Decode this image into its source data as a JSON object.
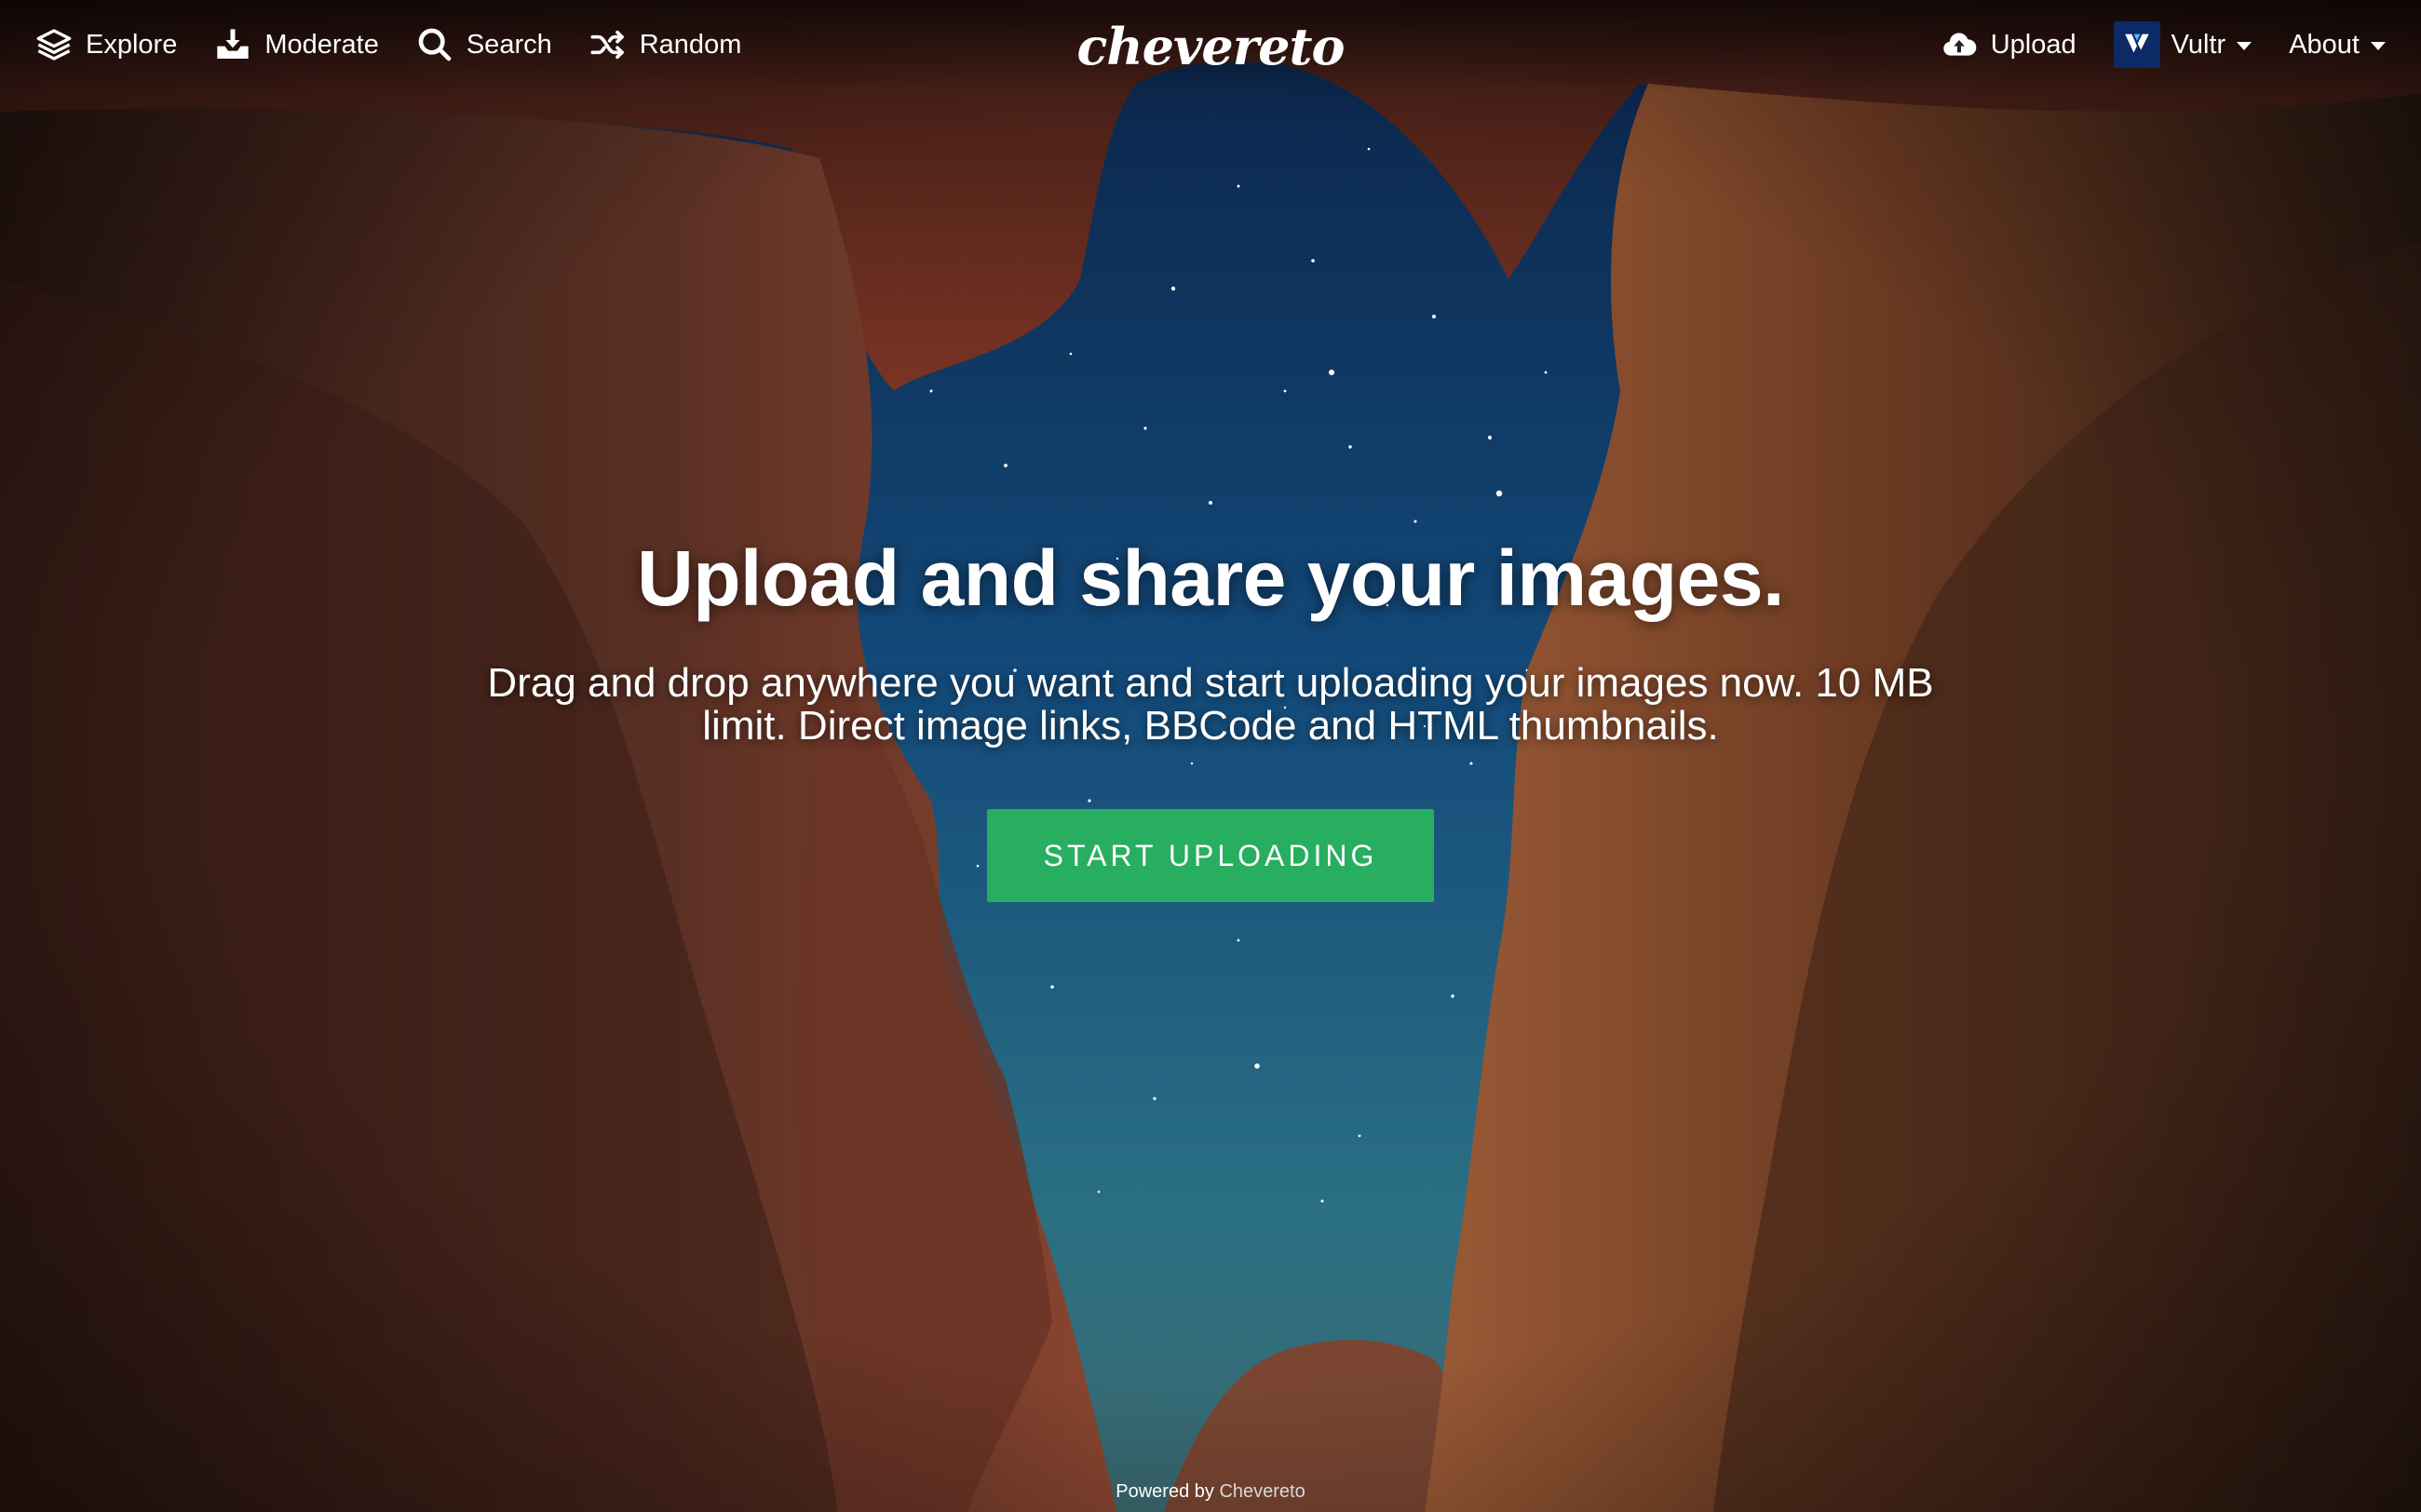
{
  "nav": {
    "left": [
      {
        "label": "Explore",
        "icon": "layers-icon"
      },
      {
        "label": "Moderate",
        "icon": "tray-download-icon"
      },
      {
        "label": "Search",
        "icon": "search-icon"
      },
      {
        "label": "Random",
        "icon": "shuffle-icon"
      }
    ],
    "logo": "chevereto",
    "right": {
      "upload": {
        "label": "Upload",
        "icon": "cloud-upload-icon"
      },
      "vultr": {
        "label": "Vultr",
        "icon": "vultr-logo-icon"
      },
      "about": {
        "label": "About"
      }
    }
  },
  "hero": {
    "title": "Upload and share your images.",
    "subtitle": "Drag and drop anywhere you want and start uploading your images now. 10 MB limit. Direct image links, BBCode and HTML thumbnails.",
    "cta": "START UPLOADING"
  },
  "footer": {
    "prefix": "Powered by ",
    "link": "Chevereto"
  },
  "colors": {
    "accent": "#27ae60",
    "vultr_badge": "#0b2a66"
  }
}
